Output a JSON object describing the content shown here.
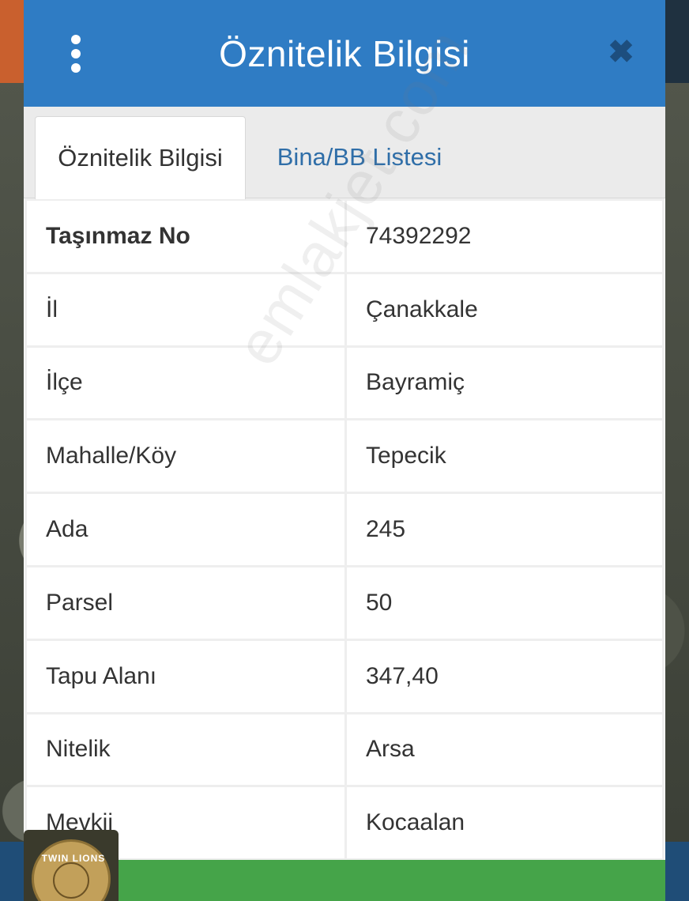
{
  "dialog": {
    "title": "Öznitelik Bilgisi",
    "close_label": "✖"
  },
  "tabs": [
    {
      "label": "Öznitelik Bilgisi",
      "active": true
    },
    {
      "label": "Bina/BB Listesi",
      "active": false
    }
  ],
  "attributes": [
    {
      "key": "Taşınmaz No",
      "value": "74392292"
    },
    {
      "key": "İl",
      "value": "Çanakkale"
    },
    {
      "key": "İlçe",
      "value": "Bayramiç"
    },
    {
      "key": "Mahalle/Köy",
      "value": "Tepecik"
    },
    {
      "key": "Ada",
      "value": "245"
    },
    {
      "key": "Parsel",
      "value": "50"
    },
    {
      "key": "Tapu Alanı",
      "value": "347,40"
    },
    {
      "key": "Nitelik",
      "value": "Arsa"
    },
    {
      "key": "Mevkii",
      "value": "Kocaalan"
    }
  ],
  "watermark": "emlakjet.com",
  "logo": {
    "text": "TWIN LIONS"
  },
  "colors": {
    "header": "#2f7cc4",
    "tab_link": "#2f6ea8",
    "footer": "#45a449"
  }
}
